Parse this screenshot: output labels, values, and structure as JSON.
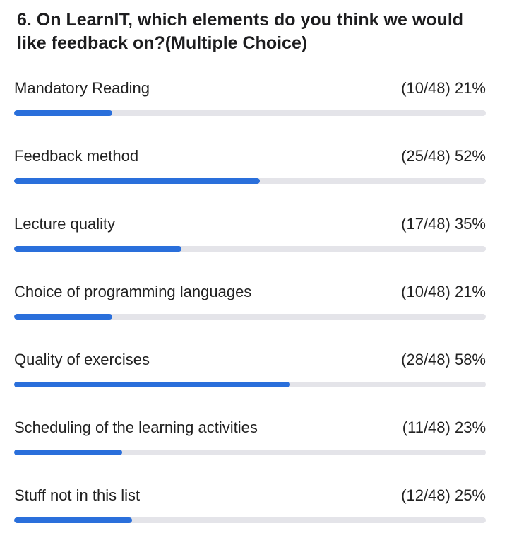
{
  "question": {
    "title": "6. On LearnIT, which elements do you think we would like feedback on?(Multiple Choice)"
  },
  "accent_color": "#2a6fdb",
  "track_color": "#e4e4e9",
  "options": [
    {
      "label": "Mandatory Reading",
      "count": 10,
      "total": 48,
      "percent": 21,
      "result": "(10/48) 21%"
    },
    {
      "label": "Feedback method",
      "count": 25,
      "total": 48,
      "percent": 52,
      "result": "(25/48) 52%"
    },
    {
      "label": "Lecture quality",
      "count": 17,
      "total": 48,
      "percent": 35,
      "result": "(17/48) 35%"
    },
    {
      "label": "Choice of programming languages",
      "count": 10,
      "total": 48,
      "percent": 21,
      "result": "(10/48) 21%"
    },
    {
      "label": "Quality of exercises",
      "count": 28,
      "total": 48,
      "percent": 58,
      "result": "(28/48) 58%"
    },
    {
      "label": "Scheduling of the learning activities",
      "count": 11,
      "total": 48,
      "percent": 23,
      "result": "(11/48) 23%"
    },
    {
      "label": "Stuff not in this list",
      "count": 12,
      "total": 48,
      "percent": 25,
      "result": "(12/48) 25%"
    }
  ]
}
